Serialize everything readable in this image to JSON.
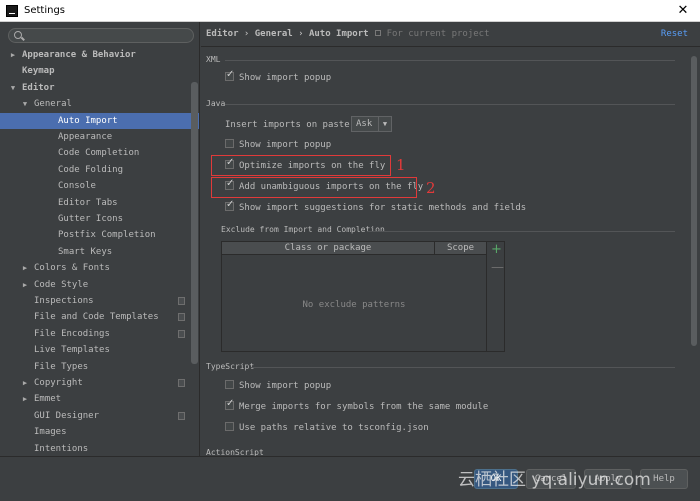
{
  "window": {
    "title": "Settings",
    "close_glyph": "✕"
  },
  "sidebar": {
    "items": [
      {
        "label": "Appearance & Behavior",
        "arrow": "▶",
        "level": 0,
        "bold": true
      },
      {
        "label": "Keymap",
        "arrow": "",
        "level": 0,
        "bold": true
      },
      {
        "label": "Editor",
        "arrow": "▼",
        "level": 0,
        "bold": true
      },
      {
        "label": "General",
        "arrow": "▼",
        "level": 1
      },
      {
        "label": "Auto Import",
        "arrow": "",
        "level": 2,
        "selected": true
      },
      {
        "label": "Appearance",
        "arrow": "",
        "level": 2
      },
      {
        "label": "Code Completion",
        "arrow": "",
        "level": 2
      },
      {
        "label": "Code Folding",
        "arrow": "",
        "level": 2
      },
      {
        "label": "Console",
        "arrow": "",
        "level": 2
      },
      {
        "label": "Editor Tabs",
        "arrow": "",
        "level": 2
      },
      {
        "label": "Gutter Icons",
        "arrow": "",
        "level": 2
      },
      {
        "label": "Postfix Completion",
        "arrow": "",
        "level": 2
      },
      {
        "label": "Smart Keys",
        "arrow": "",
        "level": 2
      },
      {
        "label": "Colors & Fonts",
        "arrow": "▶",
        "level": 1
      },
      {
        "label": "Code Style",
        "arrow": "▶",
        "level": 1
      },
      {
        "label": "Inspections",
        "arrow": "",
        "level": 1,
        "project": true
      },
      {
        "label": "File and Code Templates",
        "arrow": "",
        "level": 1,
        "project": true
      },
      {
        "label": "File Encodings",
        "arrow": "",
        "level": 1,
        "project": true
      },
      {
        "label": "Live Templates",
        "arrow": "",
        "level": 1
      },
      {
        "label": "File Types",
        "arrow": "",
        "level": 1
      },
      {
        "label": "Copyright",
        "arrow": "▶",
        "level": 1,
        "project": true
      },
      {
        "label": "Emmet",
        "arrow": "▶",
        "level": 1
      },
      {
        "label": "GUI Designer",
        "arrow": "",
        "level": 1,
        "project": true
      },
      {
        "label": "Images",
        "arrow": "",
        "level": 1
      },
      {
        "label": "Intentions",
        "arrow": "",
        "level": 1
      }
    ]
  },
  "header": {
    "breadcrumb": "Editor › General › Auto Import",
    "scope": "For current project",
    "reset": "Reset"
  },
  "xml": {
    "section": "XML",
    "show_popup": {
      "label": "Show import popup",
      "checked": true
    }
  },
  "java": {
    "section": "Java",
    "insert_label": "Insert imports on paste:",
    "insert_value": "Ask",
    "show_popup": {
      "label": "Show import popup",
      "checked": false
    },
    "optimize": {
      "label": "Optimize imports on the fly",
      "checked": true
    },
    "unambiguous": {
      "label": "Add unambiguous imports on the fly",
      "checked": true
    },
    "suggestions": {
      "label": "Show import suggestions for static methods and fields",
      "checked": true
    },
    "exclude_title": "Exclude from Import and Completion",
    "col_class": "Class or package",
    "col_scope": "Scope",
    "empty": "No exclude patterns",
    "add_glyph": "+",
    "remove_glyph": "—"
  },
  "typescript": {
    "section": "TypeScript",
    "show_popup": {
      "label": "Show import popup",
      "checked": false
    },
    "merge": {
      "label": "Merge imports for symbols  from the same module",
      "checked": true
    },
    "tsconfig": {
      "label": "Use paths relative to tsconfig.json",
      "checked": false
    }
  },
  "actionscript": {
    "section": "ActionScript"
  },
  "annotations": {
    "one": "1",
    "two": "2"
  },
  "buttons": {
    "ok": "OK",
    "cancel": "Cancel",
    "apply": "Apply",
    "help": "Help"
  },
  "watermark": "云栖社区 yq.aliyun.com"
}
